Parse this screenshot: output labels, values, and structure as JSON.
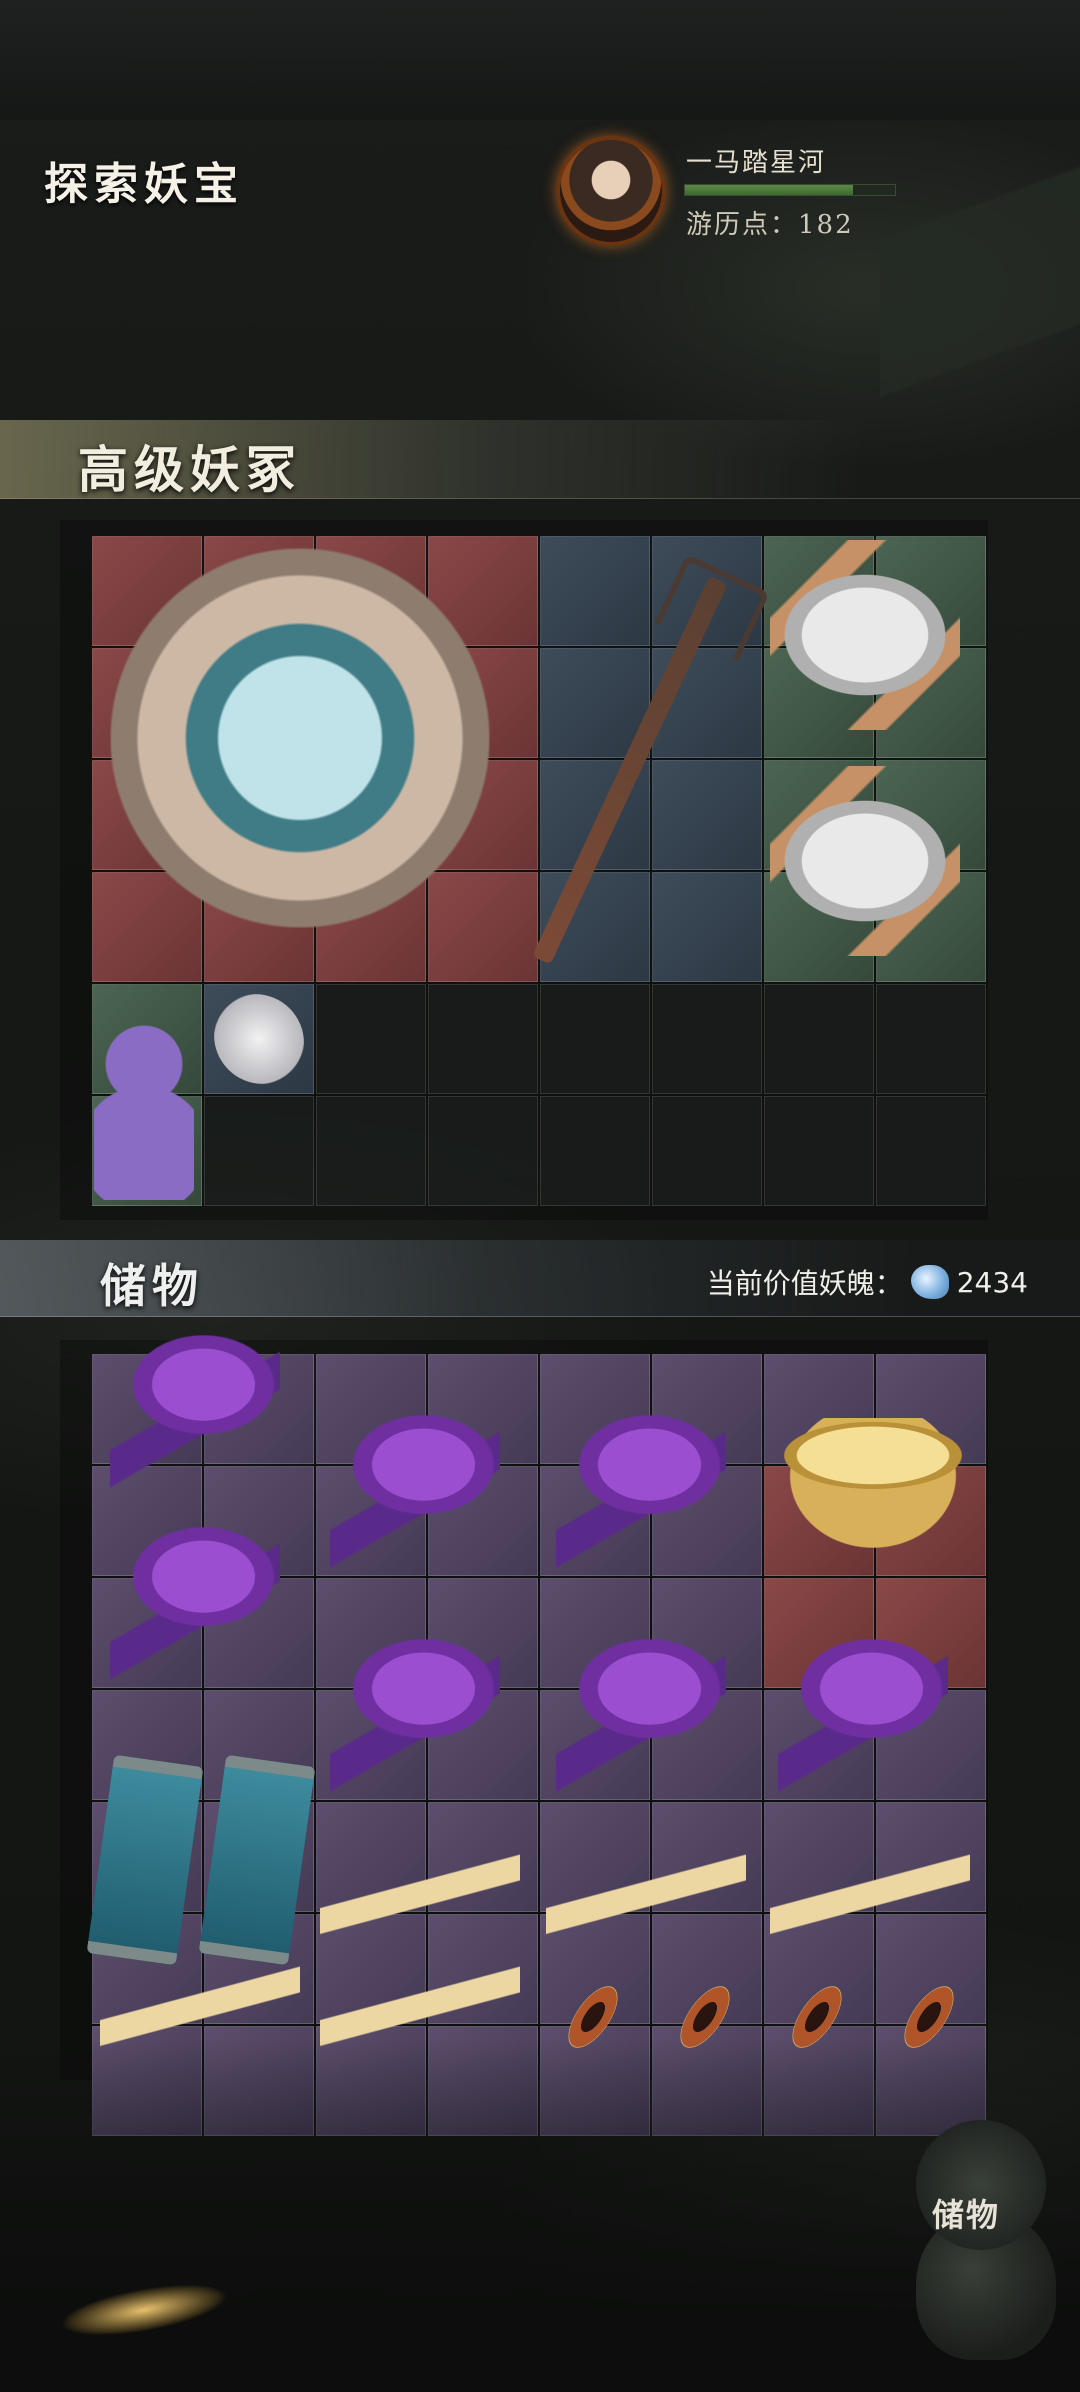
{
  "header": {
    "title": "探索妖宝"
  },
  "player": {
    "name": "一马踏星河",
    "points_label": "游历点：",
    "points": "182",
    "progress": 0.8
  },
  "loot": {
    "title": "高级妖冢",
    "cell_colors": [
      "red",
      "red",
      "red",
      "red",
      "blue",
      "blue",
      "green",
      "green",
      "red",
      "red",
      "red",
      "red",
      "blue",
      "blue",
      "green",
      "green",
      "red",
      "red",
      "red",
      "red",
      "blue",
      "blue",
      "green",
      "green",
      "red",
      "red",
      "red",
      "red",
      "blue",
      "blue",
      "green",
      "green",
      "green",
      "blue",
      "empty",
      "empty",
      "empty",
      "empty",
      "empty",
      "empty",
      "green",
      "empty",
      "empty",
      "empty",
      "empty",
      "empty",
      "empty",
      "empty"
    ],
    "items": [
      "mirror",
      "trident",
      "silk-spool",
      "silk-spool",
      "gourd",
      "cocoon"
    ]
  },
  "storage": {
    "title": "储物",
    "value_label": "当前价值妖魄：",
    "value": "2434",
    "cell_colors": [
      "purple",
      "purple",
      "purple",
      "purple",
      "purple",
      "purple",
      "purple",
      "purple",
      "purple",
      "purple",
      "purple",
      "purple",
      "purple",
      "purple",
      "red",
      "red",
      "purple",
      "purple",
      "purple",
      "purple",
      "purple",
      "purple",
      "red",
      "red",
      "purple",
      "purple",
      "purple",
      "purple",
      "purple",
      "purple",
      "purple",
      "purple",
      "purple",
      "purple",
      "purple",
      "purple",
      "purple",
      "purple",
      "purple",
      "purple",
      "purple",
      "purple",
      "purple",
      "purple",
      "purple",
      "purple",
      "purple",
      "purple",
      "purple",
      "purple",
      "purple",
      "purple",
      "purple",
      "purple",
      "purple",
      "purple"
    ],
    "items": [
      "lingzhi",
      "lingzhi",
      "lingzhi",
      "golden-bowl",
      "lingzhi",
      "lingzhi",
      "lingzhi",
      "lingzhi",
      "talisman-scroll",
      "talisman-scroll",
      "ginseng",
      "ginseng",
      "ginseng",
      "ginseng",
      "ginseng",
      "weaving-shuttle",
      "weaving-shuttle",
      "weaving-shuttle",
      "weaving-shuttle"
    ]
  },
  "storage_button": {
    "label": "储物"
  },
  "colors": {
    "red_cell": "#7a3f3f",
    "blue_cell": "#35424f",
    "green_cell": "#415847",
    "purple_cell": "#504460",
    "accent_gold": "#d9b05a"
  }
}
